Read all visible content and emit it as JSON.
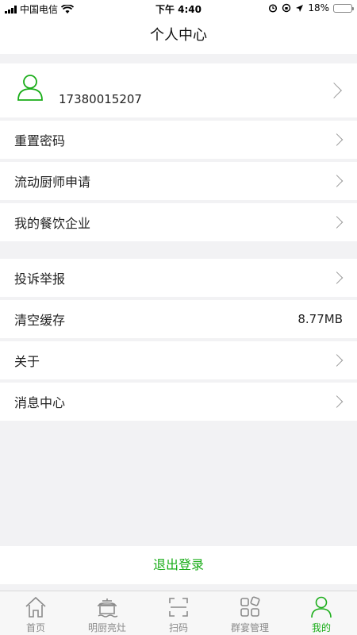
{
  "status": {
    "carrier": "中国电信",
    "time": "下午 4:40",
    "battery": "18%",
    "battery_level": 0.18
  },
  "header": {
    "title": "个人中心"
  },
  "profile": {
    "phone": "17380015207"
  },
  "menu_group1": [
    {
      "label": "重置密码"
    },
    {
      "label": "流动厨师申请"
    },
    {
      "label": "我的餐饮企业"
    }
  ],
  "menu_group2": [
    {
      "label": "投诉举报"
    },
    {
      "label": "清空缓存",
      "value": "8.77MB"
    },
    {
      "label": "关于"
    },
    {
      "label": "消息中心"
    }
  ],
  "logout": {
    "label": "退出登录"
  },
  "tabs": [
    {
      "label": "首页",
      "icon": "home-icon"
    },
    {
      "label": "明厨亮灶",
      "icon": "cooking-pot-icon"
    },
    {
      "label": "扫码",
      "icon": "scan-icon"
    },
    {
      "label": "群宴管理",
      "icon": "grid-icon"
    },
    {
      "label": "我的",
      "icon": "person-icon",
      "active": true
    }
  ],
  "colors": {
    "accent": "#1aad19",
    "background": "#f2f2f4"
  }
}
